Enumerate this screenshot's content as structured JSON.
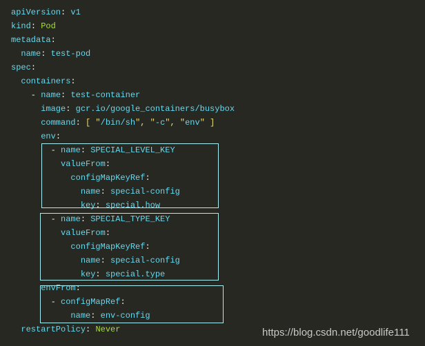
{
  "theme": {
    "background": "#272822",
    "key_color": "#66d9ef",
    "literal_color": "#a6e22e",
    "bracket_color": "#e6db74",
    "highlight_box_color": "#a8f0f4"
  },
  "code_lines": [
    [
      {
        "t": "apiVersion",
        "c": "k"
      },
      {
        "t": ": ",
        "c": "p"
      },
      {
        "t": "v1",
        "c": "v"
      }
    ],
    [
      {
        "t": "kind",
        "c": "k"
      },
      {
        "t": ": ",
        "c": "p"
      },
      {
        "t": "Pod",
        "c": "g"
      }
    ],
    [
      {
        "t": "metadata",
        "c": "k"
      },
      {
        "t": ":",
        "c": "p"
      }
    ],
    [
      {
        "t": "  name",
        "c": "k"
      },
      {
        "t": ": ",
        "c": "p"
      },
      {
        "t": "test-pod",
        "c": "v"
      }
    ],
    [
      {
        "t": "spec",
        "c": "k"
      },
      {
        "t": ":",
        "c": "p"
      }
    ],
    [
      {
        "t": "  containers",
        "c": "k"
      },
      {
        "t": ":",
        "c": "p"
      }
    ],
    [
      {
        "t": "    - ",
        "c": "p"
      },
      {
        "t": "name",
        "c": "k"
      },
      {
        "t": ": ",
        "c": "p"
      },
      {
        "t": "test-container",
        "c": "v"
      }
    ],
    [
      {
        "t": "      image",
        "c": "k"
      },
      {
        "t": ": ",
        "c": "p"
      },
      {
        "t": "gcr.io/google_containers/busybox",
        "c": "v"
      }
    ],
    [
      {
        "t": "      command",
        "c": "k"
      },
      {
        "t": ": ",
        "c": "p"
      },
      {
        "t": "[ \"",
        "c": "y"
      },
      {
        "t": "/bin/sh",
        "c": "v"
      },
      {
        "t": "\", \"",
        "c": "y"
      },
      {
        "t": "-c",
        "c": "v"
      },
      {
        "t": "\", \"",
        "c": "y"
      },
      {
        "t": "env",
        "c": "v"
      },
      {
        "t": "\" ]",
        "c": "y"
      }
    ],
    [
      {
        "t": "      env",
        "c": "k"
      },
      {
        "t": ":",
        "c": "p"
      }
    ],
    [
      {
        "t": "        - ",
        "c": "p"
      },
      {
        "t": "name",
        "c": "k"
      },
      {
        "t": ": ",
        "c": "p"
      },
      {
        "t": "SPECIAL_LEVEL_KEY",
        "c": "v"
      }
    ],
    [
      {
        "t": "          valueFrom",
        "c": "k"
      },
      {
        "t": ":",
        "c": "p"
      }
    ],
    [
      {
        "t": "            configMapKeyRef",
        "c": "k"
      },
      {
        "t": ":",
        "c": "p"
      }
    ],
    [
      {
        "t": "              name",
        "c": "k"
      },
      {
        "t": ": ",
        "c": "p"
      },
      {
        "t": "special-config",
        "c": "v"
      }
    ],
    [
      {
        "t": "              key",
        "c": "k"
      },
      {
        "t": ": ",
        "c": "p"
      },
      {
        "t": "special.how",
        "c": "v"
      }
    ],
    [
      {
        "t": "        - ",
        "c": "p"
      },
      {
        "t": "name",
        "c": "k"
      },
      {
        "t": ": ",
        "c": "p"
      },
      {
        "t": "SPECIAL_TYPE_KEY",
        "c": "v"
      }
    ],
    [
      {
        "t": "          valueFrom",
        "c": "k"
      },
      {
        "t": ":",
        "c": "p"
      }
    ],
    [
      {
        "t": "            configMapKeyRef",
        "c": "k"
      },
      {
        "t": ":",
        "c": "p"
      }
    ],
    [
      {
        "t": "              name",
        "c": "k"
      },
      {
        "t": ": ",
        "c": "p"
      },
      {
        "t": "special-config",
        "c": "v"
      }
    ],
    [
      {
        "t": "              key",
        "c": "k"
      },
      {
        "t": ": ",
        "c": "p"
      },
      {
        "t": "special.type",
        "c": "v"
      }
    ],
    [
      {
        "t": "      envFrom",
        "c": "k"
      },
      {
        "t": ":",
        "c": "p"
      }
    ],
    [
      {
        "t": "        - ",
        "c": "p"
      },
      {
        "t": "configMapRef",
        "c": "k"
      },
      {
        "t": ":",
        "c": "p"
      }
    ],
    [
      {
        "t": "            name",
        "c": "k"
      },
      {
        "t": ": ",
        "c": "p"
      },
      {
        "t": "env-config",
        "c": "v"
      }
    ],
    [
      {
        "t": "  restartPolicy",
        "c": "k"
      },
      {
        "t": ": ",
        "c": "p"
      },
      {
        "t": "Never",
        "c": "g"
      }
    ]
  ],
  "watermark": "https://blog.csdn.net/goodlife111"
}
